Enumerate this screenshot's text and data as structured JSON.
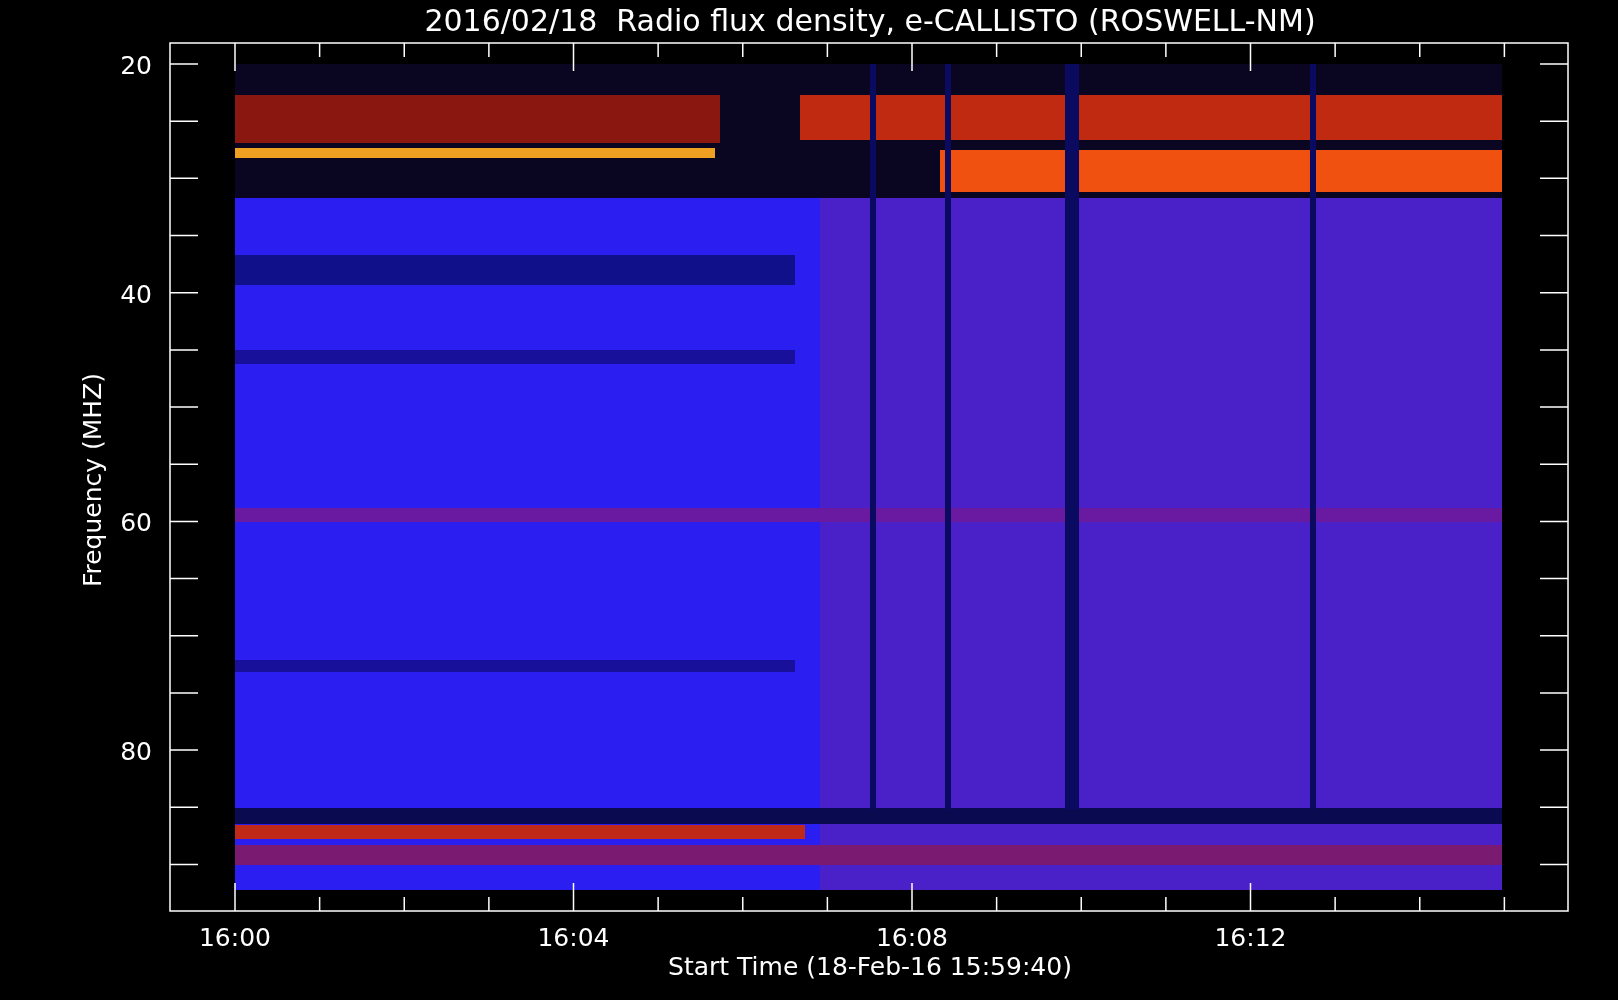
{
  "title": "2016/02/18  Radio flux density, e-CALLISTO (ROSWELL-NM)",
  "plot": {
    "ylabel": "Frequency (MHZ)",
    "xlabel": "Start Time (18-Feb-16 15:59:40)",
    "yticks": [
      "20",
      "40",
      "60",
      "80"
    ],
    "xticks": [
      "16:00",
      "16:04",
      "16:08",
      "16:12"
    ]
  }
}
